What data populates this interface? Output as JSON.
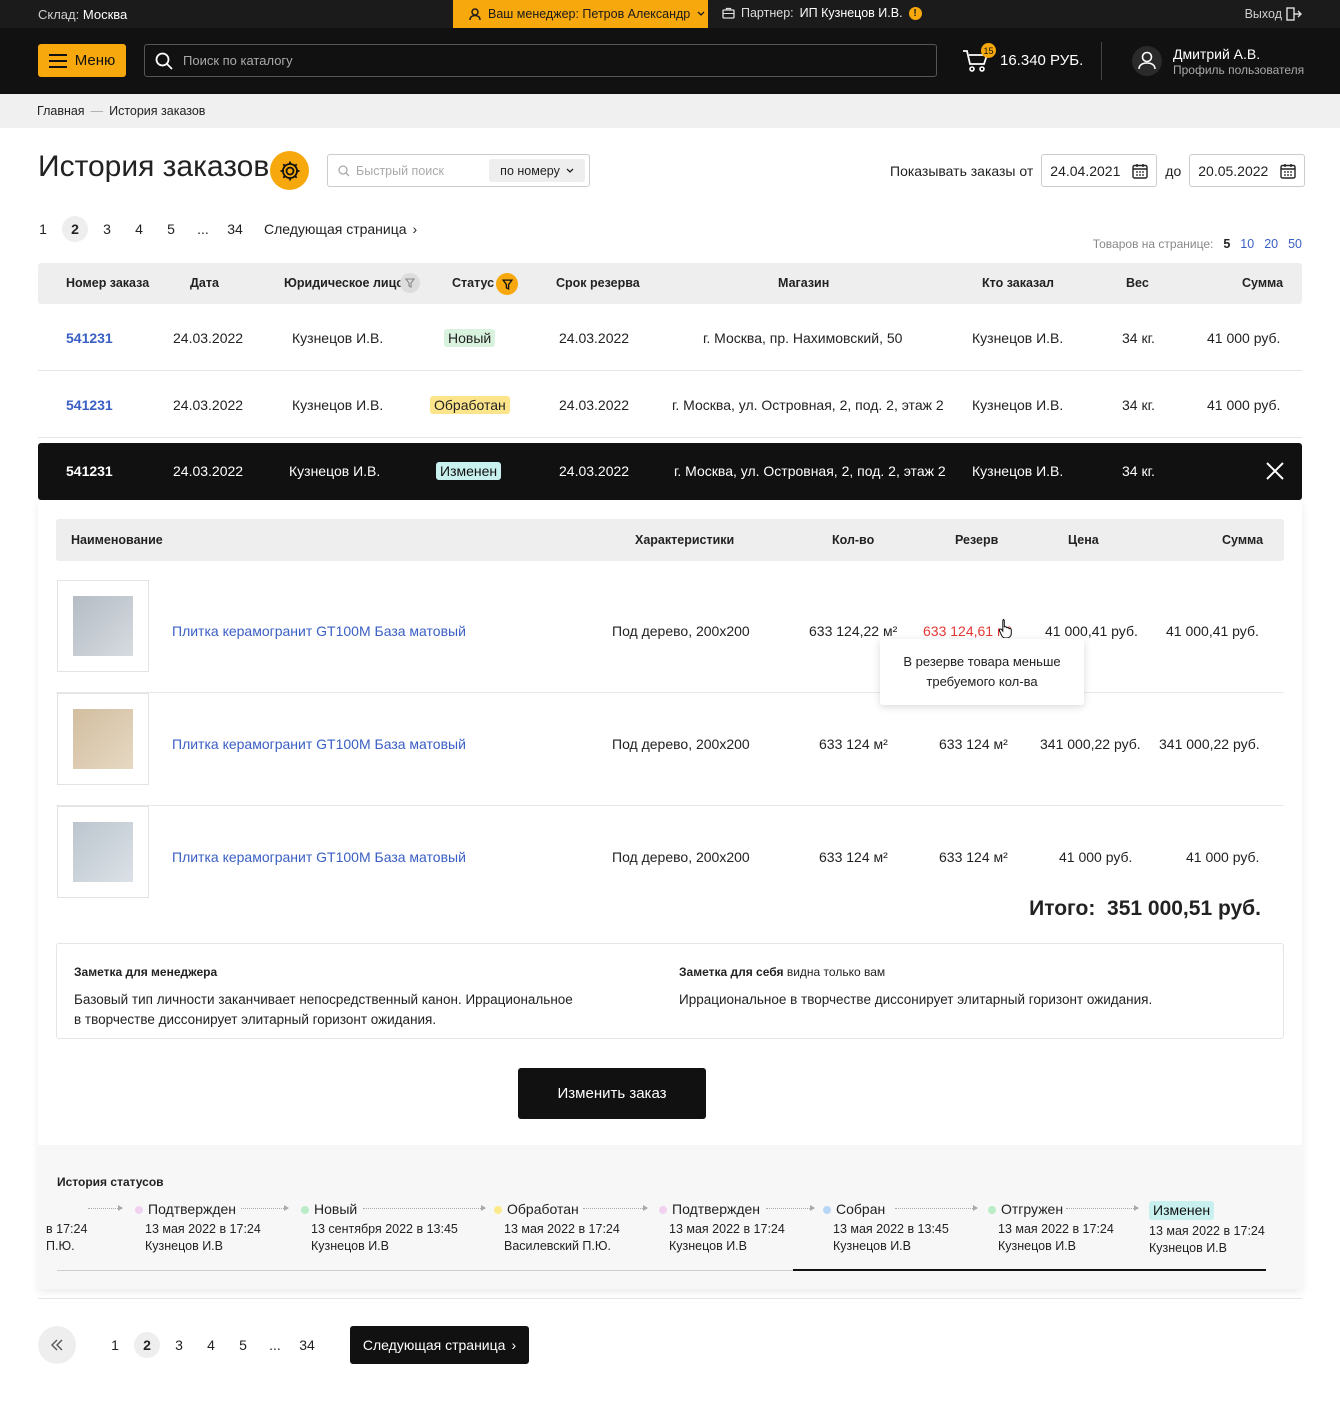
{
  "topbar": {
    "warehouse_label": "Склад:",
    "warehouse": "Москва",
    "manager_label": "Ваш менеджер: Петров Александр",
    "partner_label": "Партнер:",
    "partner": "ИП Кузнецов И.В.",
    "logout": "Выход"
  },
  "header": {
    "menu": "Меню",
    "search_placeholder": "Поиск по каталогу",
    "cart_count": "15",
    "cart_total": "16.340 РУБ.",
    "user_name": "Дмитрий А.В.",
    "user_sub": "Профиль пользователя"
  },
  "breadcrumb": {
    "home": "Главная",
    "sep": "—",
    "current": "История заказов"
  },
  "page": {
    "title": "История заказов",
    "quick_search_placeholder": "Быстрый поиск",
    "search_by": "по номеру",
    "show_from": "Показывать заказы от",
    "date_from": "24.04.2021",
    "to": "до",
    "date_to": "20.05.2022"
  },
  "pager": {
    "pages": [
      "1",
      "2",
      "3",
      "4",
      "5",
      "...",
      "34"
    ],
    "next": "Следующая страница",
    "per_page_label": "Товаров на странице:",
    "per_page": [
      "5",
      "10",
      "20",
      "50"
    ]
  },
  "table": {
    "headers": [
      "Номер заказа",
      "Дата",
      "Юридическое лицо",
      "Статус",
      "Срок резерва",
      "Магазин",
      "Кто заказал",
      "Вес",
      "Сумма"
    ],
    "rows": [
      {
        "num": "541231",
        "date": "24.03.2022",
        "entity": "Кузнецов И.В.",
        "status": "Новый",
        "reserve": "24.03.2022",
        "store": "г. Москва, пр. Нахимовский, 50",
        "who": "Кузнецов И.В.",
        "weight": "34 кг.",
        "sum": "41 000 руб."
      },
      {
        "num": "541231",
        "date": "24.03.2022",
        "entity": "Кузнецов И.В.",
        "status": "Обработан",
        "reserve": "24.03.2022",
        "store": "г. Москва, ул. Островная, 2, под. 2, этаж 2",
        "who": "Кузнецов И.В.",
        "weight": "34 кг.",
        "sum": "41 000 руб."
      }
    ],
    "expanded": {
      "num": "541231",
      "date": "24.03.2022",
      "entity": "Кузнецов И.В.",
      "status": "Изменен",
      "reserve": "24.03.2022",
      "store": "г. Москва, ул. Островная, 2, под. 2, этаж 2",
      "who": "Кузнецов И.В.",
      "weight": "34 кг."
    }
  },
  "items": {
    "headers": [
      "Наименование",
      "Характеристики",
      "Кол-во",
      "Резерв",
      "Цена",
      "Сумма"
    ],
    "rows": [
      {
        "name": "Плитка керамогранит GT100M База матовый",
        "chars": "Под дерево, 200x200",
        "qty": "633 124,22 м²",
        "reserve": "633 124,61 м²",
        "price": "41 000,41 руб.",
        "sum": "41 000,41 руб.",
        "color": "#c2c8cf"
      },
      {
        "name": "Плитка керамогранит GT100M База матовый",
        "chars": "Под дерево, 200x200",
        "qty": "633 124 м²",
        "reserve": "633 124 м²",
        "price": "341 000,22 руб.",
        "sum": "341 000,22 руб.",
        "color": "#dcc9ad"
      },
      {
        "name": "Плитка керамогранит GT100M База матовый",
        "chars": "Под дерево, 200x200",
        "qty": "633 124 м²",
        "reserve": "633 124 м²",
        "price": "41 000 руб.",
        "sum": "41 000 руб.",
        "color": "#c5cdd5"
      }
    ],
    "tooltip_1": "В резерве товара меньше",
    "tooltip_2": "требуемого кол-ва",
    "total_label": "Итого:",
    "total": "351 000,51 руб."
  },
  "notes": {
    "manager_title": "Заметка для менеджера",
    "manager_line1": "Базовый тип личности заканчивает непосредственный канон. Иррациональное",
    "manager_line2": "в творчестве диссонирует элитарный горизонт ожидания.",
    "self_title": "Заметка для себя",
    "self_hint": "видна только вам",
    "self_text": "Иррациональное в творчестве диссонирует элитарный горизонт ожидания."
  },
  "change_button": "Изменить заказ",
  "history": {
    "title": "История статусов",
    "partial": {
      "date": "в 17:24",
      "who": "П.Ю."
    },
    "items": [
      {
        "name": "Подтвержден",
        "date": "13 мая 2022 в 17:24",
        "who": "Кузнецов И.В",
        "color": "#f0d2f0"
      },
      {
        "name": "Новый",
        "date": "13 сентября 2022 в 13:45",
        "who": "Кузнецов И.В",
        "color": "#b9ecc7"
      },
      {
        "name": "Обработан",
        "date": "13 мая 2022 в 17:24",
        "who": "Василевский П.Ю.",
        "color": "#fbe98a"
      },
      {
        "name": "Подтвержден",
        "date": "13 мая 2022 в 17:24",
        "who": "Кузнецов И.В",
        "color": "#f0d2f0"
      },
      {
        "name": "Собран",
        "date": "13 мая 2022 в 13:45",
        "who": "Кузнецов И.В",
        "color": "#b8d6f5"
      },
      {
        "name": "Отгружен",
        "date": "13 мая 2022 в 17:24",
        "who": "Кузнецов И.В",
        "color": "#b9ecc7"
      },
      {
        "name": "Изменен",
        "date": "13 мая 2022 в 17:24",
        "who": "Кузнецов И.В",
        "color": "#c8f0ee"
      }
    ]
  },
  "colors": {
    "accent": "#f7a80d",
    "link": "#3a5fc4",
    "error": "#e53935",
    "dark": "#111111"
  }
}
